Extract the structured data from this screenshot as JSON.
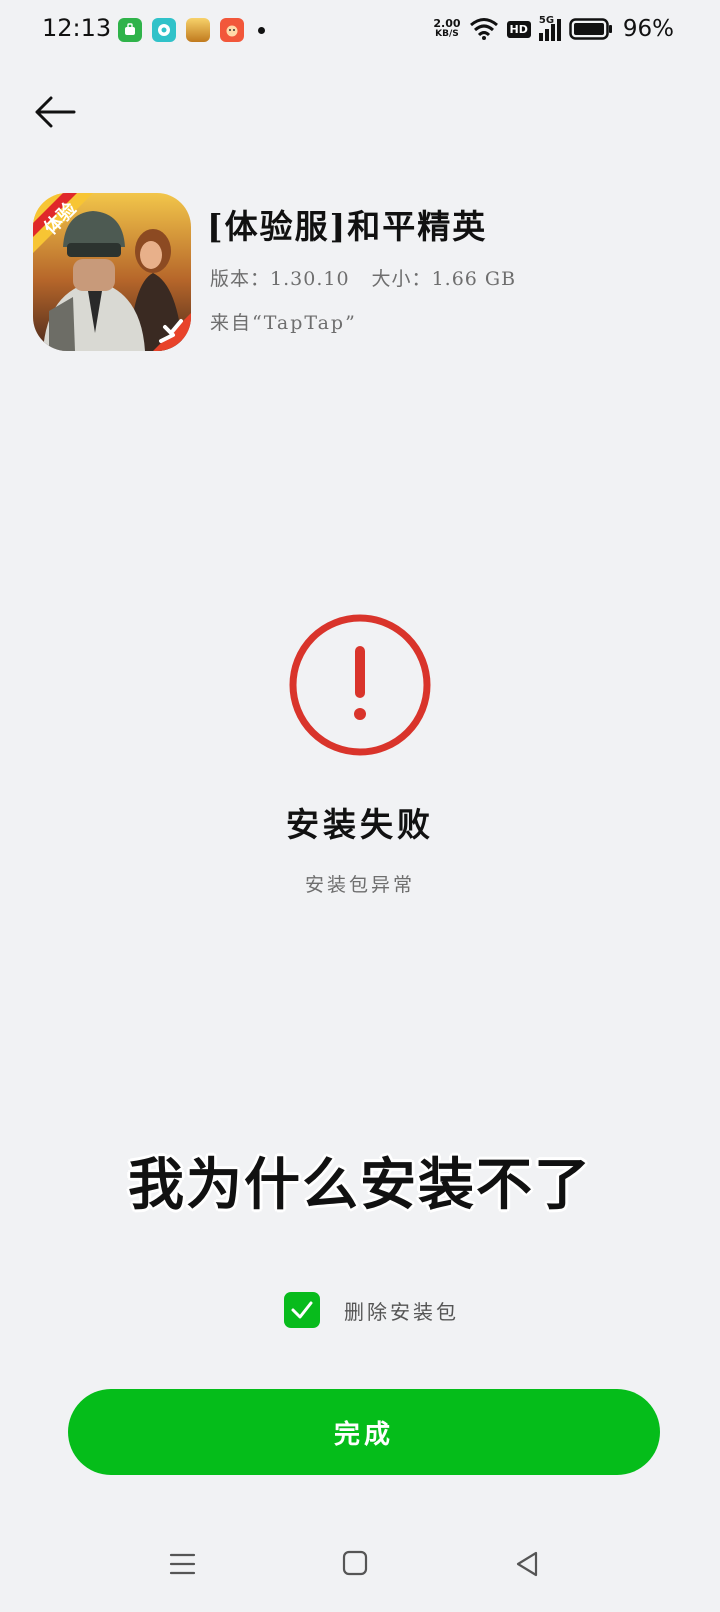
{
  "status_bar": {
    "time": "12:13",
    "speed_value": "2.00",
    "speed_unit": "KB/S",
    "hd_label": "HD",
    "network_label": "5G",
    "battery": "96%"
  },
  "app": {
    "title": "[体验服]和平精英",
    "version_label": "版本：",
    "version": "1.30.10",
    "size_label": "大小：",
    "size": "1.66 GB",
    "source": "来自“TapTap”",
    "icon_badge": "体验"
  },
  "result": {
    "title": "安装失败",
    "subtitle": "安装包异常"
  },
  "caption": "我为什么安装不了",
  "delete_package": {
    "label": "删除安装包",
    "checked": true
  },
  "done_button": "完成",
  "colors": {
    "background": "#f1f2f4",
    "accent_green": "#05bd1a",
    "error_red": "#d9342b"
  }
}
